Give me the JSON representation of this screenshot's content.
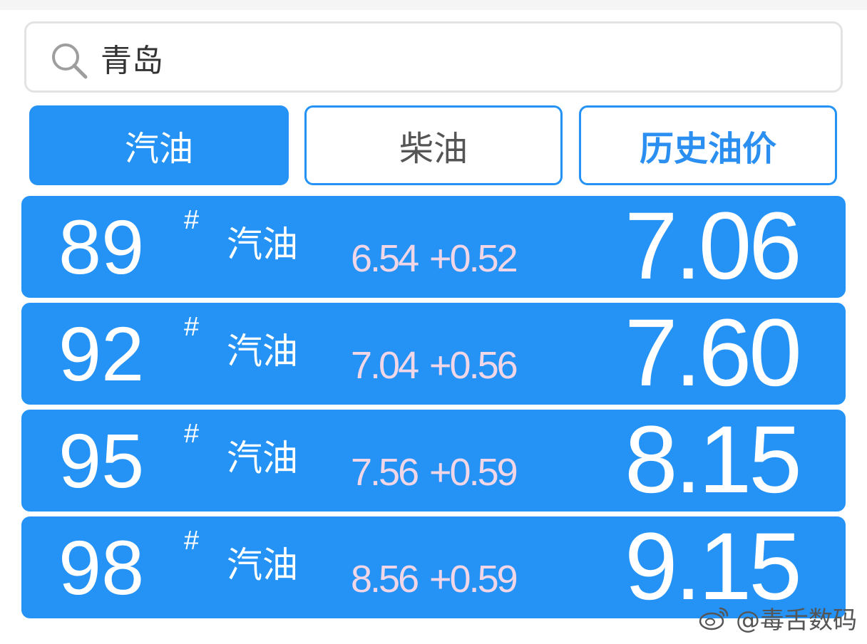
{
  "search": {
    "value": "青岛"
  },
  "tabs": [
    {
      "label": "汽油",
      "active": true
    },
    {
      "label": "柴油",
      "active": false
    },
    {
      "label": "历史油价",
      "active": false
    }
  ],
  "prices": [
    {
      "grade": "89",
      "mark": "#",
      "fuel": "汽油",
      "old_price": "6.54",
      "change": "+0.52",
      "price": "7.06"
    },
    {
      "grade": "92",
      "mark": "#",
      "fuel": "汽油",
      "old_price": "7.04",
      "change": "+0.56",
      "price": "7.60"
    },
    {
      "grade": "95",
      "mark": "#",
      "fuel": "汽油",
      "old_price": "7.56",
      "change": "+0.59",
      "price": "8.15"
    },
    {
      "grade": "98",
      "mark": "#",
      "fuel": "汽油",
      "old_price": "8.56",
      "change": "+0.59",
      "price": "9.15"
    }
  ],
  "watermark": {
    "text": "@毒舌数码"
  },
  "colors": {
    "accent": "#2593f5",
    "change_text": "#f1d6e7",
    "history_tab_text": "#2a8ff0"
  }
}
